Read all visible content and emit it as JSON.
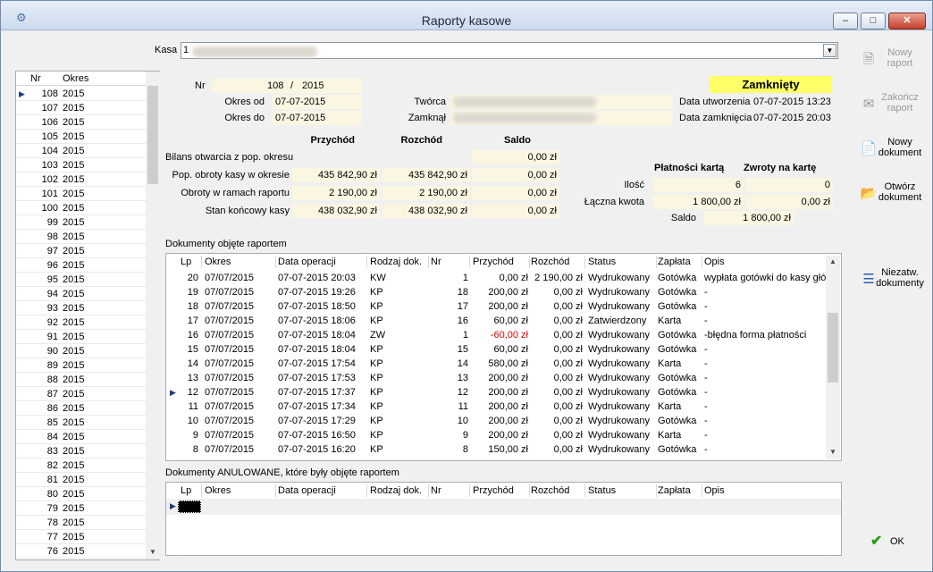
{
  "window": {
    "title": "Raporty kasowe"
  },
  "kasa": {
    "label": "Kasa",
    "value": "1"
  },
  "list": {
    "headers": [
      "Nr",
      "Okres"
    ],
    "rows": [
      [
        "108",
        "2015"
      ],
      [
        "107",
        "2015"
      ],
      [
        "106",
        "2015"
      ],
      [
        "105",
        "2015"
      ],
      [
        "104",
        "2015"
      ],
      [
        "103",
        "2015"
      ],
      [
        "102",
        "2015"
      ],
      [
        "101",
        "2015"
      ],
      [
        "100",
        "2015"
      ],
      [
        "99",
        "2015"
      ],
      [
        "98",
        "2015"
      ],
      [
        "97",
        "2015"
      ],
      [
        "96",
        "2015"
      ],
      [
        "95",
        "2015"
      ],
      [
        "94",
        "2015"
      ],
      [
        "93",
        "2015"
      ],
      [
        "92",
        "2015"
      ],
      [
        "91",
        "2015"
      ],
      [
        "90",
        "2015"
      ],
      [
        "89",
        "2015"
      ],
      [
        "88",
        "2015"
      ],
      [
        "87",
        "2015"
      ],
      [
        "86",
        "2015"
      ],
      [
        "85",
        "2015"
      ],
      [
        "84",
        "2015"
      ],
      [
        "83",
        "2015"
      ],
      [
        "82",
        "2015"
      ],
      [
        "81",
        "2015"
      ],
      [
        "80",
        "2015"
      ],
      [
        "79",
        "2015"
      ],
      [
        "78",
        "2015"
      ],
      [
        "77",
        "2015"
      ],
      [
        "76",
        "2015"
      ]
    ]
  },
  "report": {
    "nr_label": "Nr",
    "nr_value": "108",
    "nr_slash": "/",
    "nr_year": "2015",
    "okres_od_label": "Okres od",
    "okres_od": "07-07-2015",
    "okres_do_label": "Okres do",
    "okres_do": "07-07-2015",
    "tworca_label": "Twórca",
    "zamknal_label": "Zamknął",
    "status": "Zamknięty",
    "data_utw_label": "Data utworzenia",
    "data_utw": "07-07-2015 13:23",
    "data_zamk_label": "Data zamknięcia",
    "data_zamk": "07-07-2015 20:03"
  },
  "balance": {
    "headers": [
      "Przychód",
      "Rozchód",
      "Saldo"
    ],
    "rows": [
      {
        "label": "Bilans otwarcia z pop. okresu",
        "przychod": "",
        "rozchod": "",
        "saldo": "0,00 zł"
      },
      {
        "label": "Pop. obroty kasy w okresie",
        "przychod": "435 842,90 zł",
        "rozchod": "435 842,90 zł",
        "saldo": "0,00 zł"
      },
      {
        "label": "Obroty w ramach raportu",
        "przychod": "2 190,00 zł",
        "rozchod": "2 190,00 zł",
        "saldo": "0,00 zł"
      },
      {
        "label": "Stan końcowy kasy",
        "przychod": "438 032,90 zł",
        "rozchod": "438 032,90 zł",
        "saldo": "0,00 zł"
      }
    ]
  },
  "card": {
    "h1": "Płatności kartą",
    "h2": "Zwroty na kartę",
    "ilosc_label": "Ilość",
    "ilosc_1": "6",
    "ilosc_2": "0",
    "kwota_label": "Łączna kwota",
    "kwota_1": "1 800,00 zł",
    "kwota_2": "0,00 zł",
    "saldo_label": "Saldo",
    "saldo": "1 800,00 zł"
  },
  "docs": {
    "section_title": "Dokumenty objęte raportem",
    "headers": [
      "Lp",
      "Okres",
      "Data operacji",
      "Rodzaj dok.",
      "Nr",
      "Przychód",
      "Rozchód",
      "Status",
      "Zapłata",
      "Opis"
    ],
    "rows": [
      [
        "20",
        "07/07/2015",
        "07-07-2015 20:03",
        "KW",
        "1",
        "0,00 zł",
        "2 190,00 zł",
        "Wydrukowany",
        "Gotówka",
        "wypłata gotówki do kasy głó"
      ],
      [
        "19",
        "07/07/2015",
        "07-07-2015 19:26",
        "KP",
        "18",
        "200,00 zł",
        "0,00 zł",
        "Wydrukowany",
        "Gotówka",
        "-"
      ],
      [
        "18",
        "07/07/2015",
        "07-07-2015 18:50",
        "KP",
        "17",
        "200,00 zł",
        "0,00 zł",
        "Wydrukowany",
        "Gotówka",
        "-"
      ],
      [
        "17",
        "07/07/2015",
        "07-07-2015 18:06",
        "KP",
        "16",
        "60,00 zł",
        "0,00 zł",
        "Zatwierdzony",
        "Karta",
        "-"
      ],
      [
        "16",
        "07/07/2015",
        "07-07-2015 18:04",
        "ZW",
        "1",
        "-60,00 zł",
        "0,00 zł",
        "Wydrukowany",
        "Gotówka",
        "-błędna forma płatności"
      ],
      [
        "15",
        "07/07/2015",
        "07-07-2015 18:04",
        "KP",
        "15",
        "60,00 zł",
        "0,00 zł",
        "Wydrukowany",
        "Gotówka",
        "-"
      ],
      [
        "14",
        "07/07/2015",
        "07-07-2015 17:54",
        "KP",
        "14",
        "580,00 zł",
        "0,00 zł",
        "Wydrukowany",
        "Karta",
        "-"
      ],
      [
        "13",
        "07/07/2015",
        "07-07-2015 17:53",
        "KP",
        "13",
        "200,00 zł",
        "0,00 zł",
        "Wydrukowany",
        "Gotówka",
        "-"
      ],
      [
        "12",
        "07/07/2015",
        "07-07-2015 17:37",
        "KP",
        "12",
        "200,00 zł",
        "0,00 zł",
        "Wydrukowany",
        "Gotówka",
        "-"
      ],
      [
        "11",
        "07/07/2015",
        "07-07-2015 17:34",
        "KP",
        "11",
        "200,00 zł",
        "0,00 zł",
        "Wydrukowany",
        "Karta",
        "-"
      ],
      [
        "10",
        "07/07/2015",
        "07-07-2015 17:29",
        "KP",
        "10",
        "200,00 zł",
        "0,00 zł",
        "Wydrukowany",
        "Gotówka",
        "-"
      ],
      [
        "9",
        "07/07/2015",
        "07-07-2015 16:50",
        "KP",
        "9",
        "200,00 zł",
        "0,00 zł",
        "Wydrukowany",
        "Karta",
        "-"
      ],
      [
        "8",
        "07/07/2015",
        "07-07-2015 16:20",
        "KP",
        "8",
        "150,00 zł",
        "0,00 zł",
        "Wydrukowany",
        "Gotówka",
        "-"
      ]
    ]
  },
  "cancelled": {
    "section_title": "Dokumenty ANULOWANE, które były objęte raportem",
    "headers": [
      "Lp",
      "Okres",
      "Data operacji",
      "Rodzaj dok.",
      "Nr",
      "Przychód",
      "Rozchód",
      "Status",
      "Zapłata",
      "Opis"
    ]
  },
  "actions": {
    "nowy_raport": "Nowy raport",
    "zakoncz_raport": "Zakończ raport",
    "nowy_dokument": "Nowy dokument",
    "otworz_dokument": "Otwórz dokument",
    "niezatw": "Niezatw. dokumenty",
    "ok": "OK"
  },
  "colors": {
    "status_bg": "#ffff66",
    "field_bg": "#fbf6e2",
    "negative": "#e00000"
  }
}
